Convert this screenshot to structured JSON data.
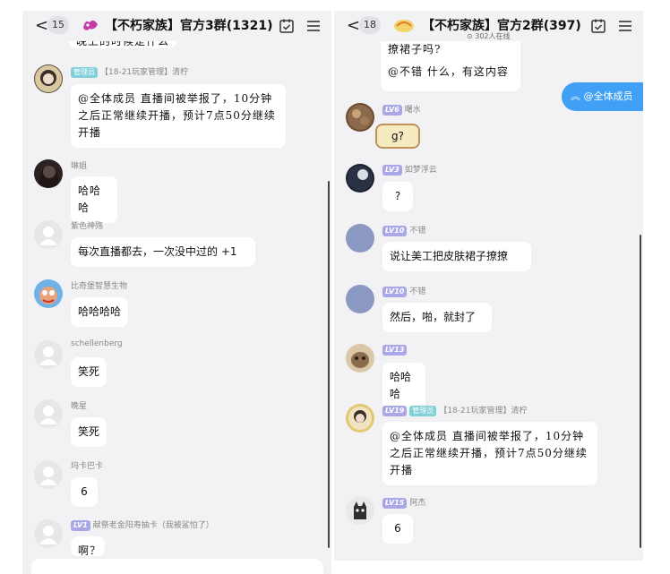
{
  "left": {
    "header": {
      "back": "<",
      "badge": "15",
      "title": "【不朽家族】官方3群(1321)"
    },
    "top_partial": "晚上的时候是什么",
    "messages": [
      {
        "admin": "管理员",
        "name": "【18-21玩家管理】清柠",
        "text": "@全体成员 直播间被举报了，10分钟之后正常继续开播，预计7点50分继续开播"
      },
      {
        "name": "琳姐",
        "text": "哈哈哈"
      },
      {
        "name": "紫色神殇",
        "text": "每次直播都去，一次没中过的 +1"
      },
      {
        "name": "比奇堡智慧生物",
        "text": "哈哈哈哈"
      },
      {
        "name": "schellenberg",
        "text": "笑死"
      },
      {
        "name": "晚星",
        "text": "笑死"
      },
      {
        "name": "玛卡巴卡",
        "text": "6"
      },
      {
        "lv": "LV1",
        "name": "献祭老金阳寿抽卡（我被鲨怕了）",
        "text": "啊？"
      }
    ]
  },
  "right": {
    "header": {
      "back": "<",
      "badge": "18",
      "title": "【不朽家族】官方2群(397)",
      "online": "⊙ 302人在线"
    },
    "top_partial": "撩裙子吗?",
    "top_msg": "@不错 什么，有这内容",
    "jump": "@全体成员",
    "messages": [
      {
        "lv": "LV6",
        "name": "曙水",
        "text": "g?"
      },
      {
        "lv": "LV3",
        "name": "如梦浮云",
        "text": "?"
      },
      {
        "lv": "LV10",
        "name": "不错",
        "text": "说让美工把皮肤裙子撩撩"
      },
      {
        "lv": "LV10",
        "name": "不错",
        "text": "然后，啪，就封了"
      },
      {
        "lv": "LV13",
        "name": "",
        "text": "哈哈哈"
      },
      {
        "lv": "LV19",
        "admin": "管理员",
        "name": "【18-21玩家管理】清柠",
        "text": "@全体成员 直播间被举报了，10分钟之后正常继续开播，预计7点50分继续开播"
      },
      {
        "lv": "LV15",
        "name": "阿杰",
        "text": "6"
      }
    ]
  }
}
